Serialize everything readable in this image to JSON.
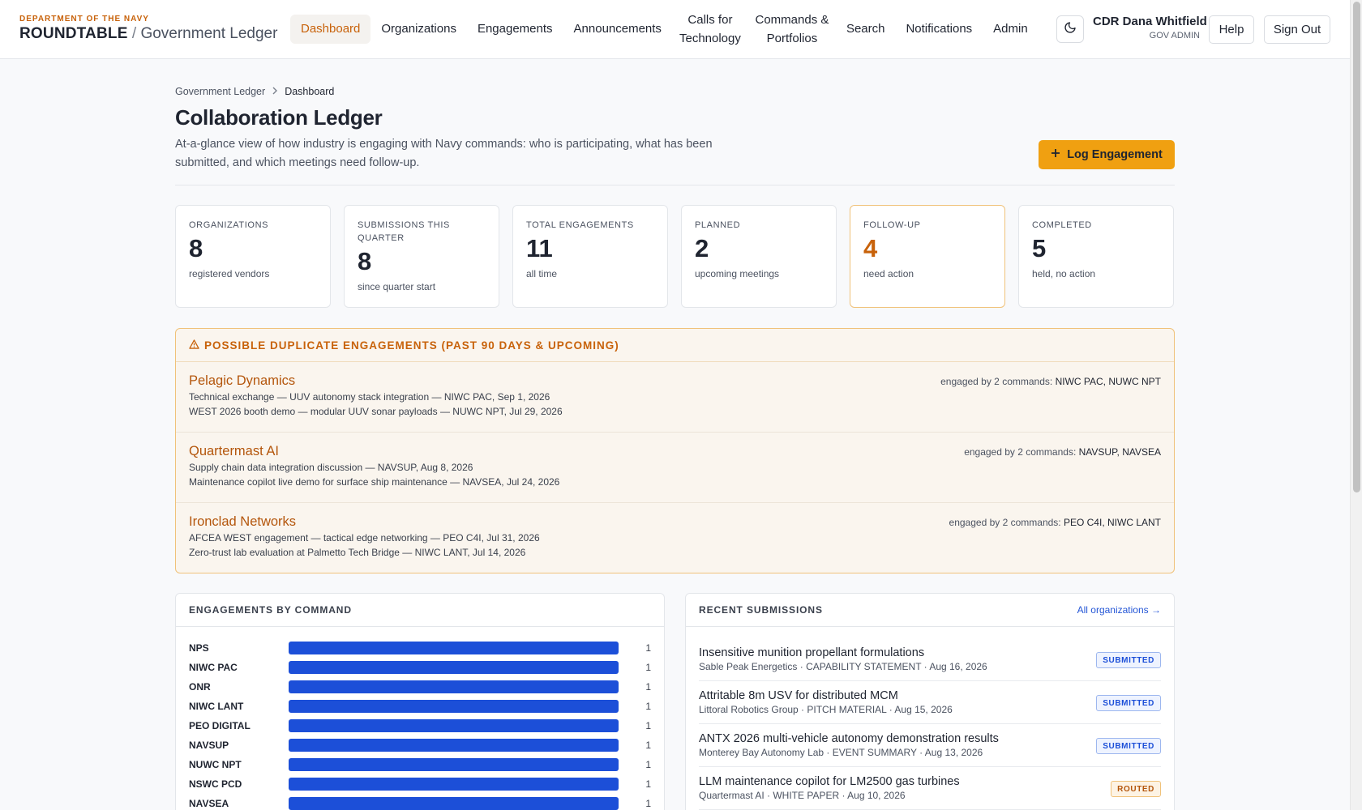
{
  "header": {
    "dept": "DEPARTMENT OF THE NAVY",
    "brand": "ROUNDTABLE",
    "brand_sep": "/",
    "brand_suffix": "Government Ledger",
    "nav": [
      {
        "label": "Dashboard",
        "active": true
      },
      {
        "label": "Organizations"
      },
      {
        "label": "Engagements"
      },
      {
        "label": "Announcements"
      },
      {
        "label": "Calls for Technology"
      },
      {
        "label": "Commands & Portfolios"
      },
      {
        "label": "Search"
      },
      {
        "label": "Notifications"
      },
      {
        "label": "Admin"
      }
    ],
    "theme_icon": "moon-icon",
    "user_name": "CDR Dana Whitfield",
    "user_role": "GOV ADMIN",
    "help_label": "Help",
    "signout_label": "Sign Out"
  },
  "breadcrumb": {
    "root": "Government Ledger",
    "current": "Dashboard"
  },
  "page": {
    "title": "Collaboration Ledger",
    "description": "At-a-glance view of how industry is engaging with Navy commands: who is participating, what has been submitted, and which meetings need follow-up.",
    "log_button": "Log Engagement"
  },
  "stats": [
    {
      "label": "ORGANIZATIONS",
      "value": "8",
      "sub": "registered vendors"
    },
    {
      "label": "SUBMISSIONS THIS QUARTER",
      "value": "8",
      "sub": "since quarter start"
    },
    {
      "label": "TOTAL ENGAGEMENTS",
      "value": "11",
      "sub": "all time"
    },
    {
      "label": "PLANNED",
      "value": "2",
      "sub": "upcoming meetings"
    },
    {
      "label": "FOLLOW-UP",
      "value": "4",
      "sub": "need action",
      "highlight": true
    },
    {
      "label": "COMPLETED",
      "value": "5",
      "sub": "held, no action"
    }
  ],
  "duplicates": {
    "title": "POSSIBLE DUPLICATE ENGAGEMENTS (PAST 90 DAYS & UPCOMING)",
    "items": [
      {
        "org": "Pelagic Dynamics",
        "meta_prefix": "engaged by 2 commands:",
        "commands": "NIWC PAC, NUWC NPT",
        "lines": [
          "Technical exchange — UUV autonomy stack integration — NIWC PAC, Sep 1, 2026",
          "WEST 2026 booth demo — modular UUV sonar payloads — NUWC NPT, Jul 29, 2026"
        ]
      },
      {
        "org": "Quartermast AI",
        "meta_prefix": "engaged by 2 commands:",
        "commands": "NAVSUP, NAVSEA",
        "lines": [
          "Supply chain data integration discussion — NAVSUP, Aug 8, 2026",
          "Maintenance copilot live demo for surface ship maintenance — NAVSEA, Jul 24, 2026"
        ]
      },
      {
        "org": "Ironclad Networks",
        "meta_prefix": "engaged by 2 commands:",
        "commands": "PEO C4I, NIWC LANT",
        "lines": [
          "AFCEA WEST engagement — tactical edge networking — PEO C4I, Jul 31, 2026",
          "Zero-trust lab evaluation at Palmetto Tech Bridge — NIWC LANT, Jul 14, 2026"
        ]
      }
    ]
  },
  "by_command": {
    "title": "ENGAGEMENTS BY COMMAND",
    "max": 1,
    "rows": [
      {
        "command": "NPS",
        "count": 1
      },
      {
        "command": "NIWC PAC",
        "count": 1
      },
      {
        "command": "ONR",
        "count": 1
      },
      {
        "command": "NIWC LANT",
        "count": 1
      },
      {
        "command": "PEO DIGITAL",
        "count": 1
      },
      {
        "command": "NAVSUP",
        "count": 1
      },
      {
        "command": "NUWC NPT",
        "count": 1
      },
      {
        "command": "NSWC PCD",
        "count": 1
      },
      {
        "command": "NAVSEA",
        "count": 1
      }
    ]
  },
  "recent": {
    "title": "RECENT SUBMISSIONS",
    "link": "All organizations →",
    "items": [
      {
        "title": "Insensitive munition propellant formulations",
        "meta": "Sable Peak Energetics · CAPABILITY STATEMENT · Aug 16, 2026",
        "status": "SUBMITTED",
        "status_kind": "submitted"
      },
      {
        "title": "Attritable 8m USV for distributed MCM",
        "meta": "Littoral Robotics Group · PITCH MATERIAL · Aug 15, 2026",
        "status": "SUBMITTED",
        "status_kind": "submitted"
      },
      {
        "title": "ANTX 2026 multi-vehicle autonomy demonstration results",
        "meta": "Monterey Bay Autonomy Lab · EVENT SUMMARY · Aug 13, 2026",
        "status": "SUBMITTED",
        "status_kind": "submitted"
      },
      {
        "title": "LLM maintenance copilot for LM2500 gas turbines",
        "meta": "Quartermast AI · WHITE PAPER · Aug 10, 2026",
        "status": "ROUTED",
        "status_kind": "routed"
      }
    ]
  }
}
